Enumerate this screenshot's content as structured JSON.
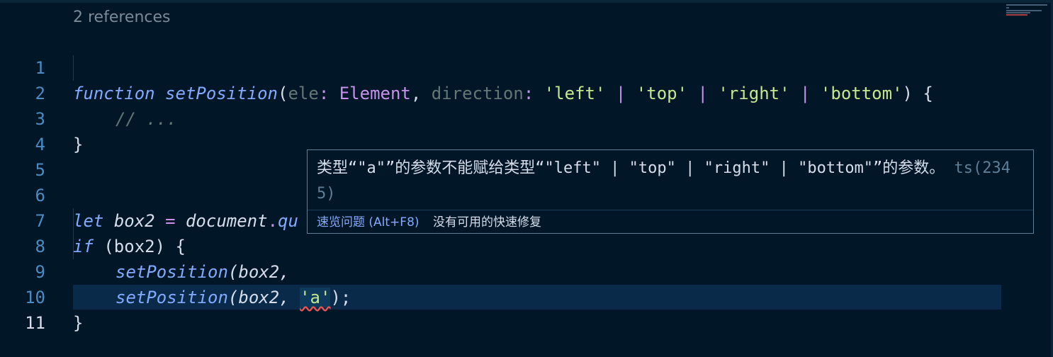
{
  "editor": {
    "codelens": "2 references",
    "line_numbers": [
      "1",
      "2",
      "3",
      "4",
      "5",
      "6",
      "7",
      "8",
      "9",
      "10",
      "11"
    ],
    "line1": {
      "kw": "function",
      "name": "setPosition",
      "p_open": "(",
      "param1": "ele",
      "colon1": ":",
      "type1": "Element",
      "comma1": ",",
      "param2": "direction",
      "colon2": ":",
      "s1": "'left'",
      "bar1": "|",
      "s2": "'top'",
      "bar2": "|",
      "s3": "'right'",
      "bar3": "|",
      "s4": "'bottom'",
      "close": ") {"
    },
    "line2": {
      "comment": "// ..."
    },
    "line3": {
      "close": "}"
    },
    "line6": {
      "kw": "let",
      "var": "box2",
      "eq": "=",
      "obj": "document",
      "dot": ".",
      "meth": "qu"
    },
    "line7": {
      "kw": "if",
      "cond": "(box2) {"
    },
    "line8": {
      "fn": "setPosition",
      "args": "(box2,"
    },
    "line9": {
      "fn": "setPosition",
      "args": "(box2,",
      "err_arg": "'a'",
      "tail": ");"
    },
    "line10": {
      "close": "}"
    }
  },
  "hover": {
    "message": "类型“\"a\"”的参数不能赋给类型“\"left\" | \"top\" | \"right\" | \"bottom\"”的参数。",
    "code": "ts(2345)",
    "peek_label": "速览问题 (Alt+F8)",
    "no_fix_label": "没有可用的快速修复"
  },
  "colors": {
    "background": "#011627",
    "keyword": "#82aaff",
    "string": "#c3e88d",
    "type": "#c792ea",
    "error_squiggle": "#ef5350"
  }
}
